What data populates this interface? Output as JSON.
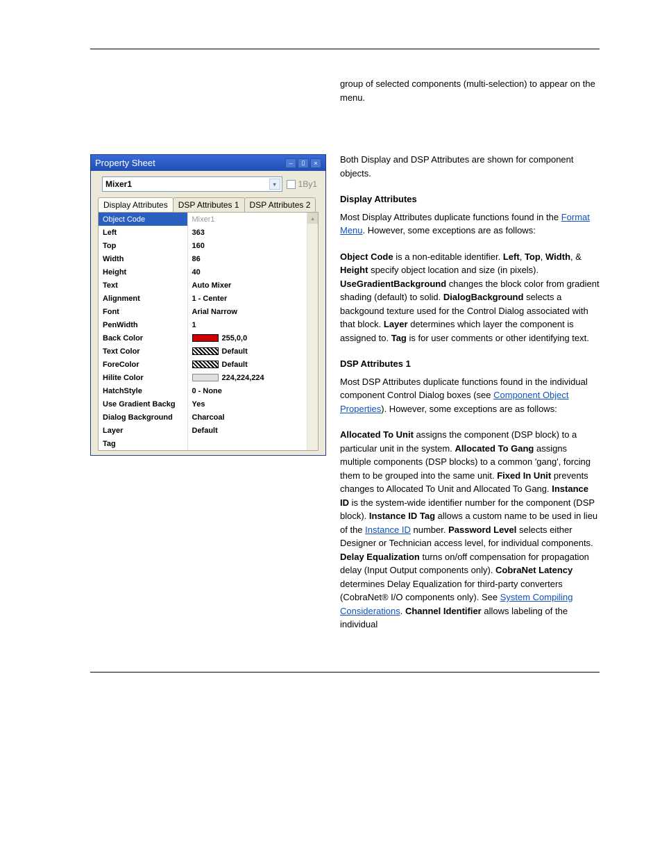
{
  "intro_snippet": "group of selected components (multi-selection) to appear on the menu.",
  "property_sheet": {
    "title": "Property Sheet",
    "combo_value": "Mixer1",
    "checkbox_label": "1By1",
    "tabs": [
      "Display Attributes",
      "DSP Attributes 1",
      "DSP Attributes 2"
    ],
    "rows": [
      {
        "label": "Object Code",
        "value": "Mixer1",
        "first": true
      },
      {
        "label": "Left",
        "value": "363"
      },
      {
        "label": "Top",
        "value": "160"
      },
      {
        "label": "Width",
        "value": "86"
      },
      {
        "label": "Height",
        "value": "40"
      },
      {
        "label": "Text",
        "value": "Auto Mixer"
      },
      {
        "label": "Alignment",
        "value": "1 - Center"
      },
      {
        "label": "Font",
        "value": "Arial Narrow"
      },
      {
        "label": "PenWidth",
        "value": "1"
      },
      {
        "label": "Back Color",
        "value": "255,0,0",
        "swatch": "red"
      },
      {
        "label": "Text Color",
        "value": "Default",
        "swatch": "hatch"
      },
      {
        "label": "ForeColor",
        "value": "Default",
        "swatch": "hatch"
      },
      {
        "label": "Hilite Color",
        "value": "224,224,224",
        "swatch": "grey"
      },
      {
        "label": "HatchStyle",
        "value": "0 - None"
      },
      {
        "label": "Use Gradient Backg",
        "value": "Yes"
      },
      {
        "label": "Dialog Background",
        "value": "Charcoal"
      },
      {
        "label": "Layer",
        "value": "Default"
      },
      {
        "label": "Tag",
        "value": ""
      }
    ]
  },
  "right": {
    "p1": "Both Display and DSP Attributes are shown for component objects.",
    "display_heading": "Display Attributes",
    "p2_a": "Most Display Attributes duplicate functions found in the ",
    "p2_link": "Format Menu",
    "p2_b": ". However, some exceptions are as follows:",
    "p3_objectcode": "Object Code",
    "p3_a": " is a non-editable identifier. ",
    "p3_left": "Left",
    "p3_sep1": ", ",
    "p3_top": "Top",
    "p3_sep2": ", ",
    "p3_width": "Width",
    "p3_sep3": ", & ",
    "p3_height": "Height",
    "p3_b": " specify object location and size (in pixels). ",
    "p3_gradient": "UseGradientBackground",
    "p3_c": " changes the block color from gradient shading (default) to solid. ",
    "p3_dialog": "DialogBackground",
    "p3_d": " selects a backgound texture used for the Control Dialog associated with that block. ",
    "p3_layer": "Layer",
    "p3_e": " determines which layer the component is assigned to. ",
    "p3_tag": "Tag",
    "p3_f": " is for user comments or other identifying text.",
    "dsp_heading": "DSP Attributes 1",
    "p4_a": "Most DSP Attributes duplicate functions found in the individual component Control Dialog boxes (see ",
    "p4_link": "Component Object Properties",
    "p4_b": "). However, some exceptions are as follows:",
    "p5_allocunit": "Allocated To Unit",
    "p5_a": " assigns the component (DSP block) to a particular unit in the system. ",
    "p5_allocgang": "Allocated To Gang",
    "p5_b": " assigns multiple components (DSP blocks) to a common 'gang', forcing them to be grouped into the same unit. ",
    "p5_fixed": "Fixed In Unit",
    "p5_c": " prevents changes to Allocated To Unit and Allocated To Gang. ",
    "p5_instance": "Instance ID",
    "p5_d": " is the system-wide identifier number for the component (DSP block). ",
    "p5_instancetag": "Instance ID Tag",
    "p5_e": " allows a custom name to be used in lieu of the ",
    "p5_instlink": "Instance ID",
    "p5_e2": " number. ",
    "p5_password": "Password Level",
    "p5_f": " selects either Designer or Technician access level, for individual components. ",
    "p5_delayeq": "Delay Equalization",
    "p5_g": " turns on/off compensation for propagation delay (Input Output components only). ",
    "p5_cobralat": "CobraNet Latency",
    "p5_h": " determines Delay Equalization for third-party converters (CobraNet® I/O components only). See ",
    "p5_syslink": "System Compiling Considerations",
    "p5_i": ". ",
    "p5_channel": "Channel Identifier",
    "p5_j": " allows labeling of the individual"
  }
}
